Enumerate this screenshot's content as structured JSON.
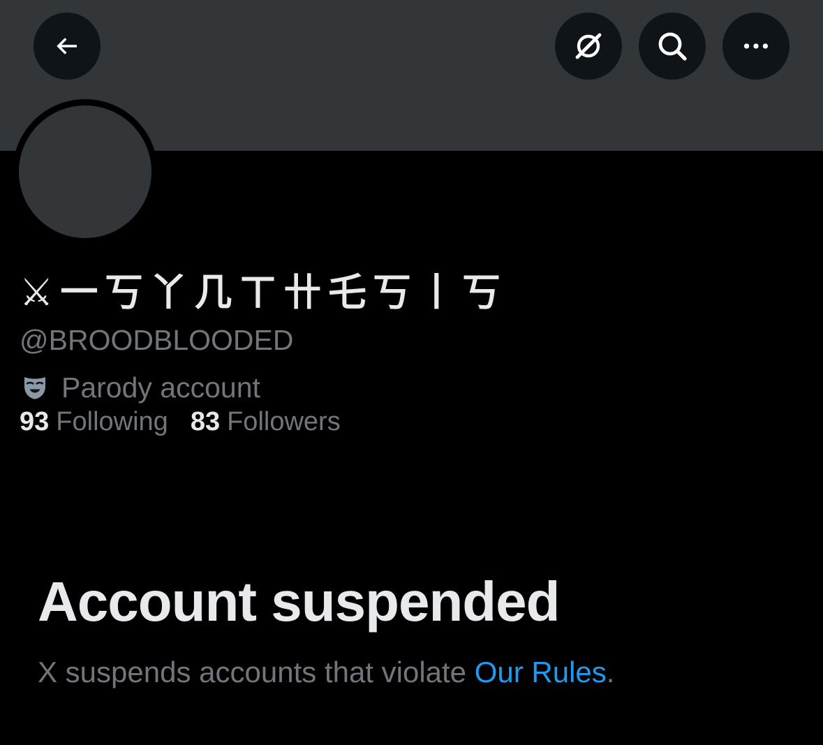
{
  "header": {
    "back_icon": "arrow-left-icon",
    "grok_icon": "grok-icon",
    "search_icon": "search-icon",
    "more_icon": "more-horizontal-icon"
  },
  "profile": {
    "display_name": "⚔︎一丂丫几ㄒ卄乇丂丨丂",
    "handle": "@BROODBLOODED",
    "parody_label": "Parody account",
    "parody_icon": "theater-mask-icon",
    "following_count": "93",
    "following_label": "Following",
    "followers_count": "83",
    "followers_label": "Followers"
  },
  "suspension": {
    "title": "Account suspended",
    "message": "X suspends accounts that violate ",
    "rules_link": "Our Rules",
    "period": "."
  },
  "colors": {
    "background": "#000000",
    "banner": "#333639",
    "button_bg": "#0f1419",
    "primary_text": "#e7e9ea",
    "secondary_text": "#71767b",
    "link": "#1d9bf0"
  }
}
